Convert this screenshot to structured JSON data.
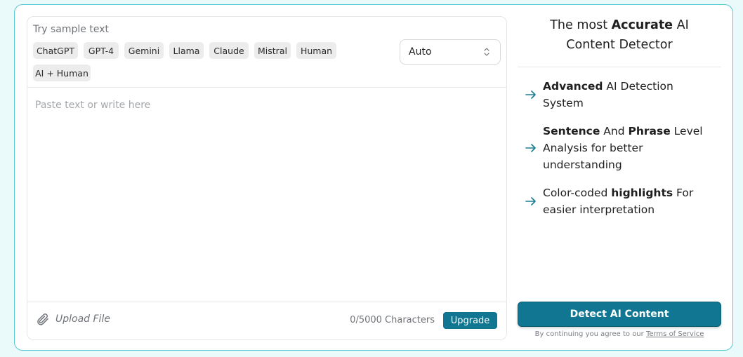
{
  "sample": {
    "title": "Try sample text",
    "chips": [
      "ChatGPT",
      "GPT-4",
      "Gemini",
      "Llama",
      "Claude",
      "Mistral",
      "Human",
      "AI + Human"
    ]
  },
  "mode_select": {
    "value": "Auto"
  },
  "editor": {
    "placeholder": "Paste text or write here",
    "value": ""
  },
  "footer": {
    "upload_label": "Upload File",
    "char_count": "0/5000 Characters",
    "upgrade_label": "Upgrade"
  },
  "headline": {
    "prefix": "The most ",
    "bold": "Accurate",
    "suffix": " AI",
    "line2": "Content Detector"
  },
  "features": [
    {
      "parts": [
        {
          "b": "Advanced"
        },
        {
          "t": " AI Detection System"
        }
      ]
    },
    {
      "parts": [
        {
          "b": "Sentence"
        },
        {
          "t": " And "
        },
        {
          "b": "Phrase"
        },
        {
          "t": " Level Analysis for better understanding"
        }
      ]
    },
    {
      "parts": [
        {
          "t": "Color-coded "
        },
        {
          "b": "highlights"
        },
        {
          "t": " For easier interpretation"
        }
      ]
    }
  ],
  "detect_button": "Detect AI Content",
  "terms": {
    "prefix": "By continuing you agree to our ",
    "link": "Terms of Service"
  },
  "colors": {
    "accent": "#107691",
    "border": "#58c9d0",
    "background": "#eafafb",
    "arrow": "#1b7b93"
  },
  "icons": {
    "upload": "paperclip-icon",
    "select": "chevron-updown-icon",
    "feature": "arrow-right-icon"
  }
}
